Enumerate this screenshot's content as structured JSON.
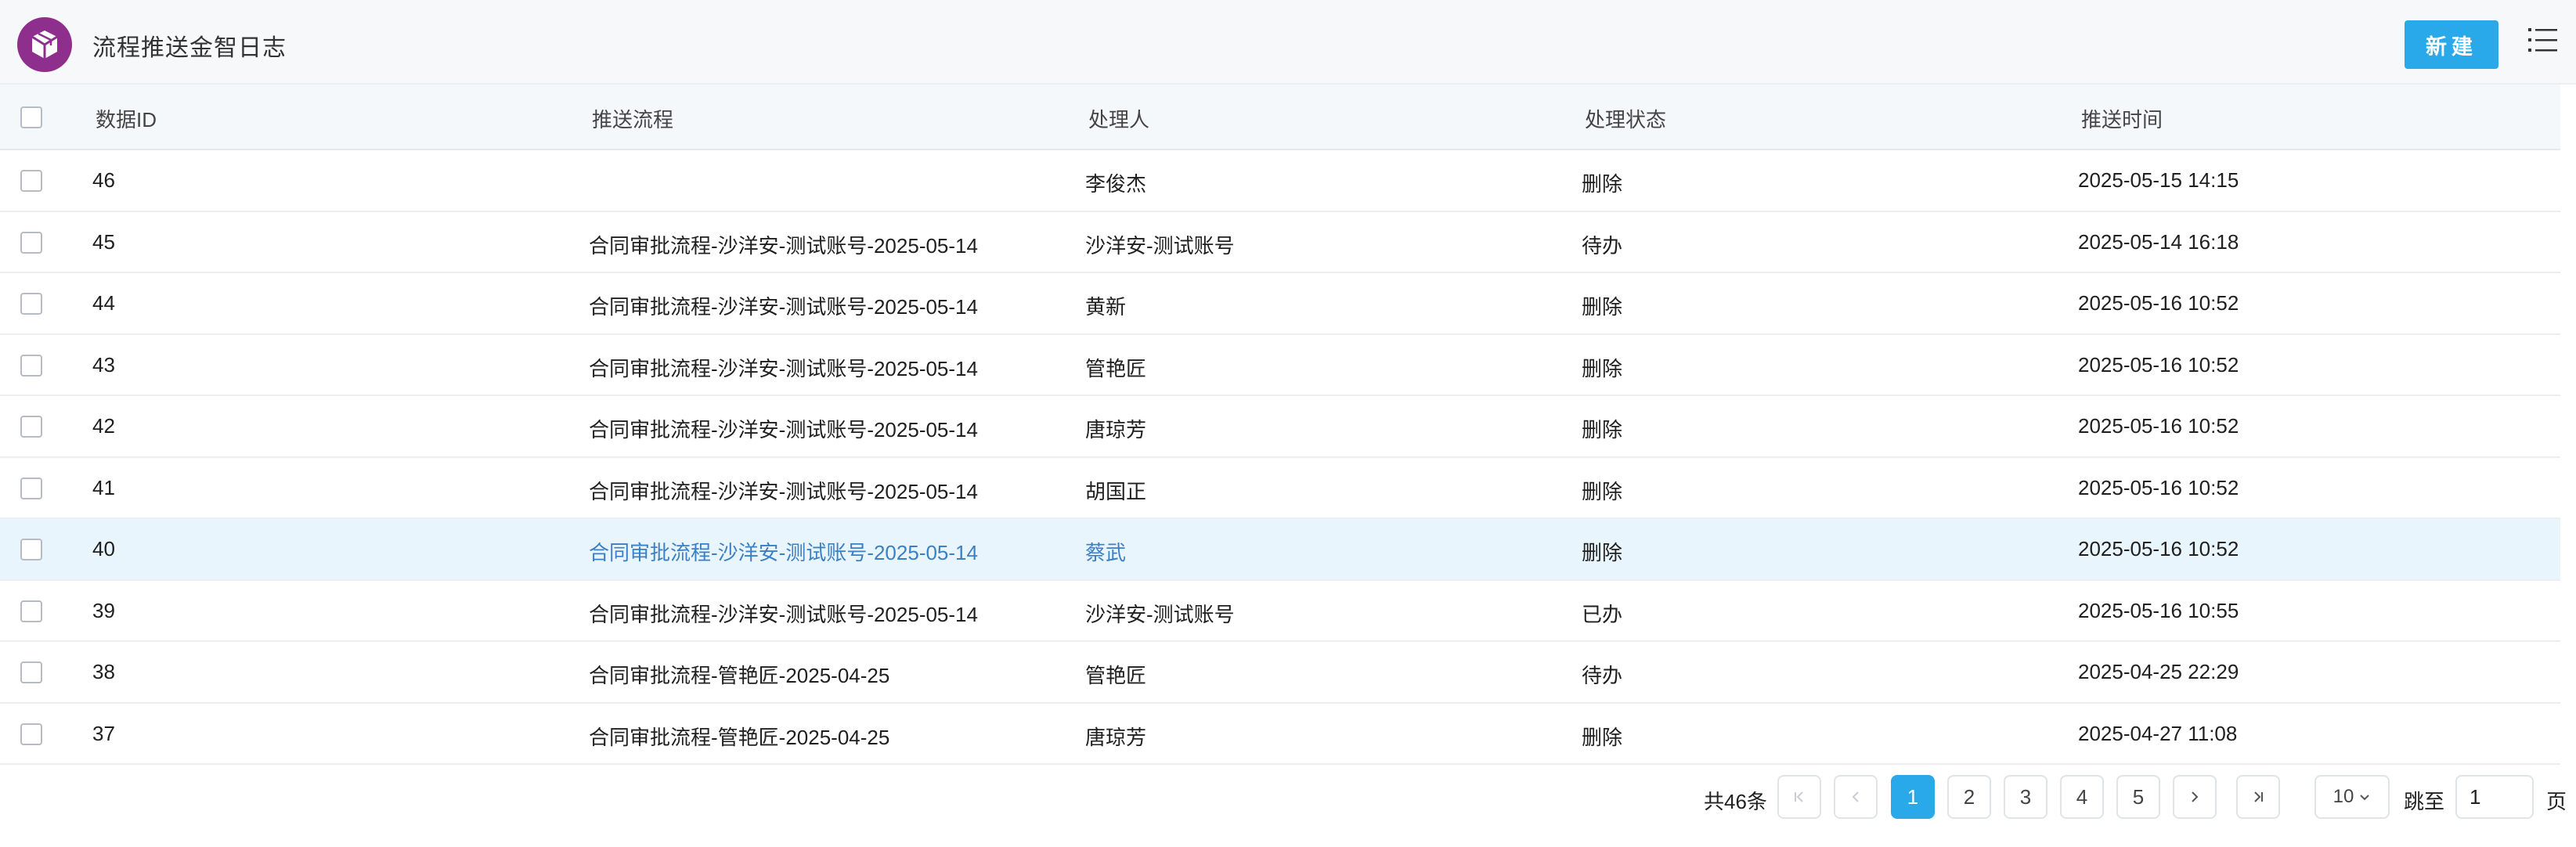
{
  "header": {
    "title": "流程推送金智日志",
    "logo_icon": "cube-icon",
    "new_button": "新建",
    "menu_icon": "list-icon",
    "accent": "#29a9e9",
    "logo_color": "#8f2f8d"
  },
  "table": {
    "columns": {
      "id": "数据ID",
      "flow": "推送流程",
      "handler": "处理人",
      "status": "处理状态",
      "time": "推送时间"
    },
    "rows": [
      {
        "id": "46",
        "flow": "",
        "handler": "李俊杰",
        "status": "删除",
        "time": "2025-05-15 14:15"
      },
      {
        "id": "45",
        "flow": "合同审批流程-沙洋安-测试账号-2025-05-14",
        "handler": "沙洋安-测试账号",
        "status": "待办",
        "time": "2025-05-14 16:18"
      },
      {
        "id": "44",
        "flow": "合同审批流程-沙洋安-测试账号-2025-05-14",
        "handler": "黄新",
        "status": "删除",
        "time": "2025-05-16 10:52"
      },
      {
        "id": "43",
        "flow": "合同审批流程-沙洋安-测试账号-2025-05-14",
        "handler": "管艳匠",
        "status": "删除",
        "time": "2025-05-16 10:52"
      },
      {
        "id": "42",
        "flow": "合同审批流程-沙洋安-测试账号-2025-05-14",
        "handler": "唐琼芳",
        "status": "删除",
        "time": "2025-05-16 10:52"
      },
      {
        "id": "41",
        "flow": "合同审批流程-沙洋安-测试账号-2025-05-14",
        "handler": "胡国正",
        "status": "删除",
        "time": "2025-05-16 10:52"
      },
      {
        "id": "40",
        "flow": "合同审批流程-沙洋安-测试账号-2025-05-14",
        "handler": "蔡武",
        "status": "删除",
        "time": "2025-05-16 10:52"
      },
      {
        "id": "39",
        "flow": "合同审批流程-沙洋安-测试账号-2025-05-14",
        "handler": "沙洋安-测试账号",
        "status": "已办",
        "time": "2025-05-16 10:55"
      },
      {
        "id": "38",
        "flow": "合同审批流程-管艳匠-2025-04-25",
        "handler": "管艳匠",
        "status": "待办",
        "time": "2025-04-25 22:29"
      },
      {
        "id": "37",
        "flow": "合同审批流程-管艳匠-2025-04-25",
        "handler": "唐琼芳",
        "status": "删除",
        "time": "2025-04-27 11:08"
      }
    ],
    "highlighted_row_id": "40"
  },
  "pagination": {
    "total": "共46条",
    "pages": [
      "1",
      "2",
      "3",
      "4",
      "5"
    ],
    "current": "1",
    "page_size": "10",
    "jump_label": "跳至",
    "jump_value": "1",
    "page_unit": "页"
  }
}
